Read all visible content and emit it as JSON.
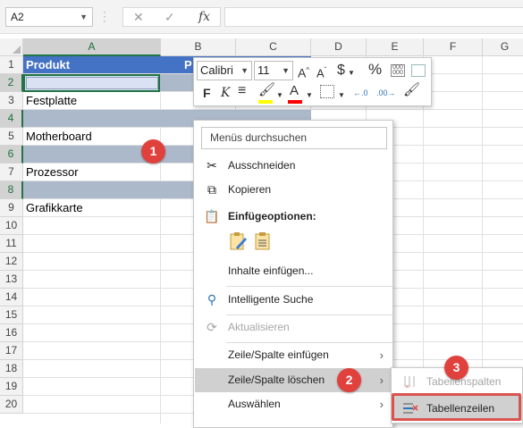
{
  "formula_bar": {
    "name_box": "A2",
    "cancel_icon": "✕",
    "enter_icon": "✓",
    "fx_label": "fx",
    "formula": ""
  },
  "columns": [
    "A",
    "B",
    "C",
    "D",
    "E",
    "F",
    "G"
  ],
  "rows": [
    "1",
    "2",
    "3",
    "4",
    "5",
    "6",
    "7",
    "8",
    "9",
    "10",
    "11",
    "12",
    "13",
    "14",
    "15",
    "16",
    "17",
    "18",
    "19",
    "20"
  ],
  "cells": {
    "a1": "Produkt",
    "b1": "P",
    "a3": "Festplatte",
    "a5": "Motherboard",
    "a7": "Prozessor",
    "a9": "Grafikkarte"
  },
  "mini_toolbar": {
    "font_name": "Calibri",
    "font_size": "11",
    "grow_font": "A",
    "shrink_font": "A",
    "currency": "$",
    "percent": "%",
    "bold": "F",
    "italic": "K",
    "font_color_letter": "A",
    "decrease_decimal": "←.0",
    "increase_decimal": ".00→"
  },
  "context_menu": {
    "search_placeholder": "Menüs durchsuchen",
    "items": {
      "cut": "Ausschneiden",
      "copy": "Kopieren",
      "paste_options": "Einfügeoptionen:",
      "paste_special": "Inhalte einfügen...",
      "smart_lookup": "Intelligente Suche",
      "refresh": "Aktualisieren",
      "insert": "Zeile/Spalte einfügen",
      "delete": "Zeile/Spalte löschen",
      "select": "Auswählen"
    },
    "submenu": {
      "table_columns": "Tabellenspalten",
      "table_rows": "Tabellenzeilen"
    }
  },
  "callouts": [
    "1",
    "2",
    "3"
  ],
  "colors": {
    "excel_green": "#217346",
    "table_header": "#4472c4",
    "banded_row": "#acb9ca",
    "callout_red": "#e0413d"
  }
}
